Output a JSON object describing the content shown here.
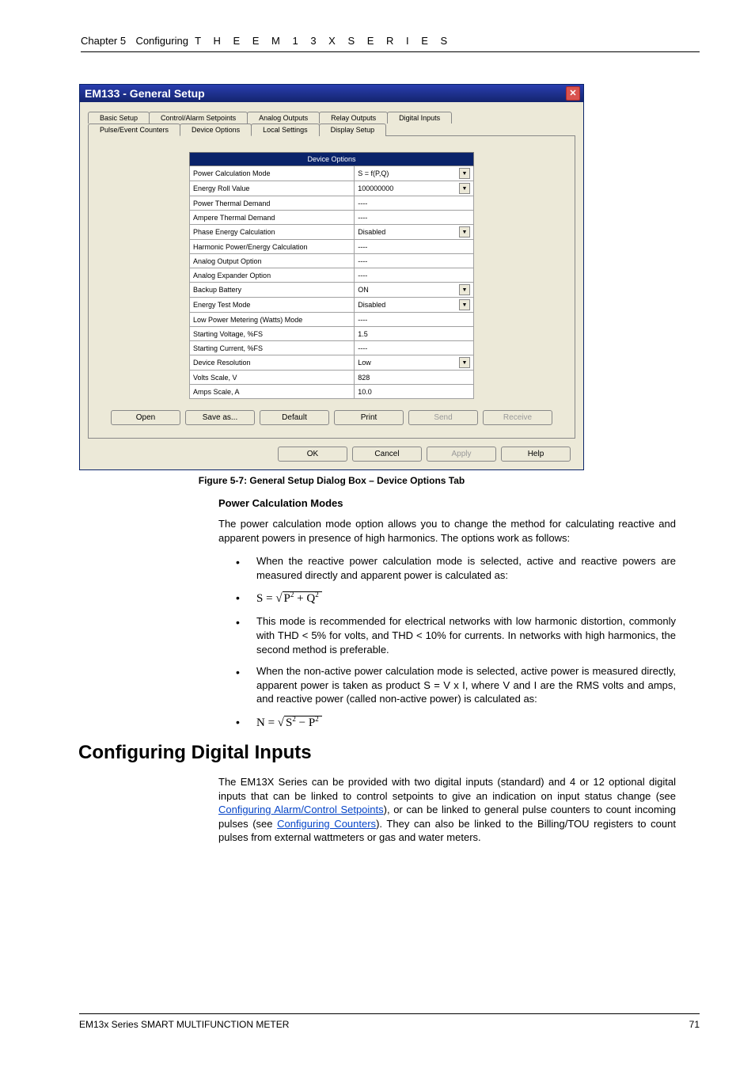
{
  "header": {
    "chapter_word": "Chapter 5",
    "chapter_rest": "Configuring",
    "spaced_title": "T H E   E M 1 3 X   S E R I E S"
  },
  "dialog": {
    "title": "EM133 - General Setup",
    "tabs_row1": [
      "Basic Setup",
      "Control/Alarm Setpoints",
      "Analog Outputs",
      "Relay Outputs",
      "Digital Inputs"
    ],
    "tabs_row2": [
      "Pulse/Event Counters",
      "Device Options",
      "Local Settings",
      "Display Setup"
    ],
    "active_tab": "Device Options",
    "table_header": "Device Options",
    "rows": [
      {
        "label": "Power Calculation Mode",
        "value": "S = f(P,Q)",
        "dropdown": true
      },
      {
        "label": "Energy Roll Value",
        "value": "100000000",
        "dropdown": true
      },
      {
        "label": "Power Thermal Demand",
        "value": "----",
        "dropdown": false
      },
      {
        "label": "Ampere Thermal Demand",
        "value": "----",
        "dropdown": false
      },
      {
        "label": "Phase Energy Calculation",
        "value": "Disabled",
        "dropdown": true
      },
      {
        "label": "Harmonic Power/Energy Calculation",
        "value": "----",
        "dropdown": false
      },
      {
        "label": "Analog Output Option",
        "value": "----",
        "dropdown": false
      },
      {
        "label": "Analog Expander Option",
        "value": "----",
        "dropdown": false
      },
      {
        "label": "Backup Battery",
        "value": "ON",
        "dropdown": true
      },
      {
        "label": "Energy Test Mode",
        "value": "Disabled",
        "dropdown": true
      },
      {
        "label": "Low Power Metering (Watts) Mode",
        "value": "----",
        "dropdown": false
      },
      {
        "label": "Starting Voltage, %FS",
        "value": "1.5",
        "dropdown": false
      },
      {
        "label": "Starting Current, %FS",
        "value": "----",
        "dropdown": false
      },
      {
        "label": "Device Resolution",
        "value": "Low",
        "dropdown": true
      },
      {
        "label": "Volts Scale, V",
        "value": "828",
        "dropdown": false
      },
      {
        "label": "Amps Scale, A",
        "value": "10.0",
        "dropdown": false
      }
    ],
    "buttons_row1": [
      {
        "label": "Open",
        "enabled": true
      },
      {
        "label": "Save as...",
        "enabled": true
      },
      {
        "label": "Default",
        "enabled": true
      },
      {
        "label": "Print",
        "enabled": true
      },
      {
        "label": "Send",
        "enabled": false
      },
      {
        "label": "Receive",
        "enabled": false
      }
    ],
    "buttons_row2": [
      {
        "label": "OK",
        "enabled": true
      },
      {
        "label": "Cancel",
        "enabled": true
      },
      {
        "label": "Apply",
        "enabled": false
      },
      {
        "label": "Help",
        "enabled": true
      }
    ]
  },
  "caption": "Figure 5-7:  General Setup Dialog Box – Device Options Tab",
  "subheading": "Power Calculation Modes",
  "para_intro": "The power calculation mode option allows you to change the method for calculating reactive and apparent powers in presence of high harmonics. The options work as follows:",
  "list": [
    {
      "text": "When the reactive power calculation mode is selected, active and reactive powers are measured directly and apparent power is calculated as:"
    },
    {
      "formula": {
        "lhs": "S",
        "sub": "P² + Q²"
      }
    },
    {
      "text": "This mode is recommended for electrical networks with low harmonic distortion, commonly with THD < 5% for volts, and THD < 10% for currents. In networks with high harmonics, the second method is preferable."
    },
    {
      "text": "When the non-active power calculation mode is selected, active power is measured directly, apparent power is taken as product S = V x I, where V and I are the RMS volts and amps, and reactive power (called non-active power) is calculated as:"
    },
    {
      "formula": {
        "lhs": "N",
        "sub": "S² − P²"
      }
    }
  ],
  "section_heading": "Configuring Digital Inputs",
  "para_digital_a": "The EM13X Series can be provided with two  digital inputs (standard) and 4 or 12 optional digital inputs that can be linked to control setpoints to give an indication on input status change (see ",
  "link1": "Configuring Alarm/Control Setpoints",
  "para_digital_b": "), or can be linked to general pulse counters to count incoming pulses (see ",
  "link2": "Configuring Counters",
  "para_digital_c": "). They can also be linked to the Billing/TOU registers to count pulses from external wattmeters or gas and water meters.",
  "footer_left": "EM13x Series SMART MULTIFUNCTION METER",
  "footer_right": "71"
}
